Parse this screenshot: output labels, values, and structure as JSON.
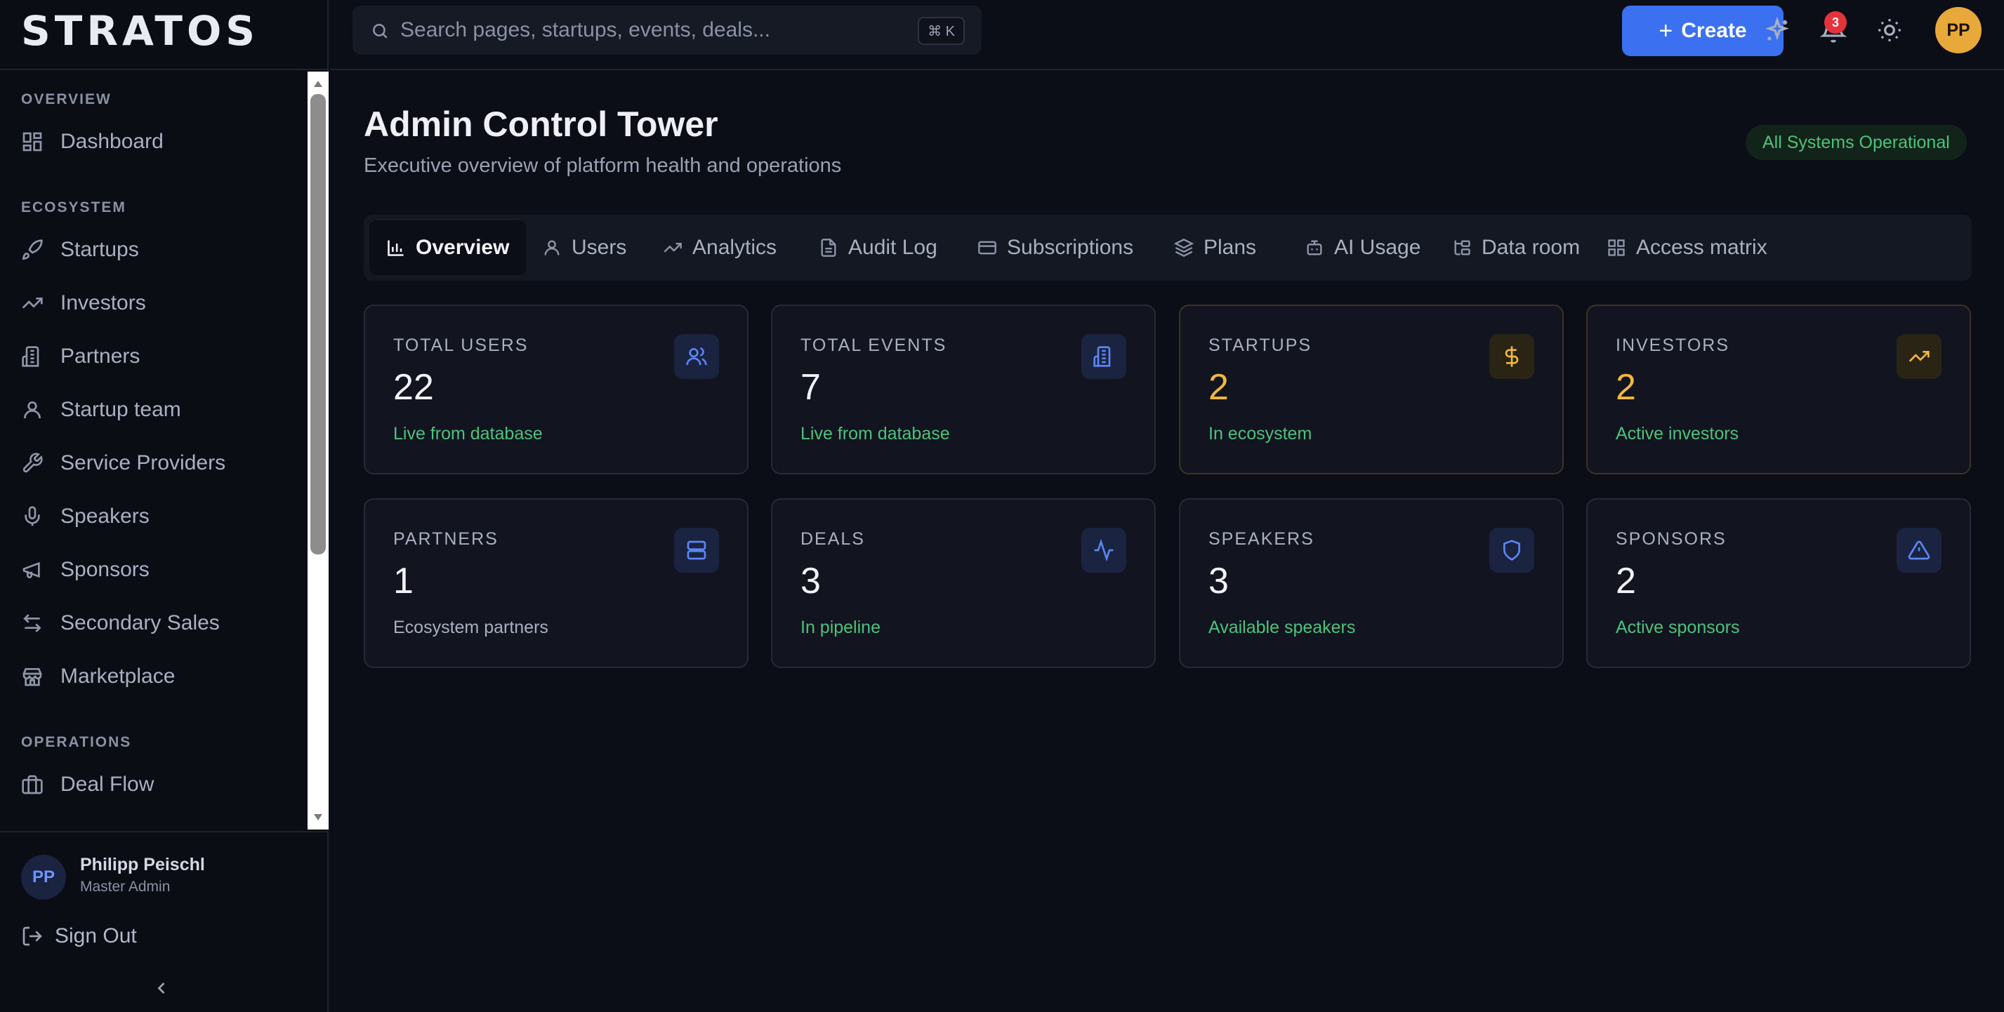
{
  "app": {
    "logo": "STRATOS"
  },
  "sidebar": {
    "sections": {
      "overview": "OVERVIEW",
      "ecosystem": "ECOSYSTEM",
      "operations": "OPERATIONS"
    },
    "items": {
      "dashboard": "Dashboard",
      "startups": "Startups",
      "investors": "Investors",
      "partners": "Partners",
      "startup_team": "Startup team",
      "service_providers": "Service Providers",
      "speakers": "Speakers",
      "sponsors": "Sponsors",
      "secondary_sales": "Secondary Sales",
      "marketplace": "Marketplace",
      "deal_flow": "Deal Flow"
    },
    "user": {
      "initials": "PP",
      "name": "Philipp Peischl",
      "role": "Master Admin"
    },
    "sign_out": "Sign Out"
  },
  "topbar": {
    "search_placeholder": "Search pages, startups, events, deals...",
    "shortcut": "⌘ K",
    "create_label": "Create",
    "notification_count": "3",
    "avatar_initials": "PP"
  },
  "page": {
    "title": "Admin Control Tower",
    "subtitle": "Executive overview of platform health and operations",
    "status": "All Systems Operational"
  },
  "tabs": {
    "overview": "Overview",
    "users": "Users",
    "analytics": "Analytics",
    "audit_log": "Audit Log",
    "subscriptions": "Subscriptions",
    "plans": "Plans",
    "ai_usage": "AI Usage",
    "data_room": "Data room",
    "access_matrix": "Access matrix"
  },
  "stats": [
    {
      "label": "TOTAL USERS",
      "value": "22",
      "note": "Live from database",
      "icon": "users-icon"
    },
    {
      "label": "TOTAL EVENTS",
      "value": "7",
      "note": "Live from database",
      "icon": "building-icon"
    },
    {
      "label": "STARTUPS",
      "value": "2",
      "note": "In ecosystem",
      "icon": "dollar-icon"
    },
    {
      "label": "INVESTORS",
      "value": "2",
      "note": "Active investors",
      "icon": "trending-up-icon"
    },
    {
      "label": "PARTNERS",
      "value": "1",
      "note": "Ecosystem partners",
      "icon": "server-icon"
    },
    {
      "label": "DEALS",
      "value": "3",
      "note": "In pipeline",
      "icon": "activity-icon"
    },
    {
      "label": "SPEAKERS",
      "value": "3",
      "note": "Available speakers",
      "icon": "shield-icon"
    },
    {
      "label": "SPONSORS",
      "value": "2",
      "note": "Active sponsors",
      "icon": "alert-triangle-icon"
    }
  ],
  "colors": {
    "accent": "#3b71f0",
    "gold": "#f0b93c",
    "success": "#4cc27a",
    "badge": "#e5323b"
  }
}
